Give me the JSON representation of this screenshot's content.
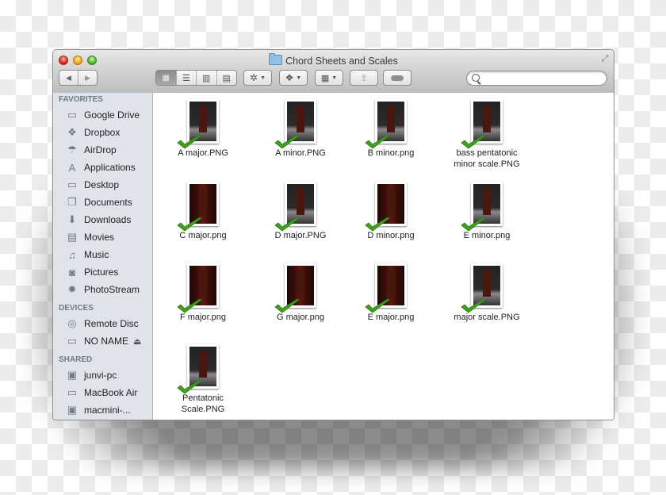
{
  "window": {
    "title": "Chord Sheets and Scales"
  },
  "toolbar": {
    "back_icon": "◀",
    "forward_icon": "▶",
    "view_icons": [
      "icon-view-icon",
      "list-view-icon",
      "column-view-icon",
      "cover-flow-view-icon"
    ],
    "view_glyphs": [
      "▦",
      "☰",
      "▥",
      "▤"
    ],
    "action_glyph": "✲",
    "dropbox_glyph": "❖",
    "arrange_glyph": "▦",
    "share_glyph": "⇪",
    "tags_glyph": "▬",
    "caret": "▼",
    "search_placeholder": "",
    "search_value": ""
  },
  "sidebar": {
    "favorites_title": "FAVORITES",
    "favorites": [
      {
        "label": "Google Drive",
        "icon": "folder-icon",
        "glyph": "▭"
      },
      {
        "label": "Dropbox",
        "icon": "dropbox-icon",
        "glyph": "❖"
      },
      {
        "label": "AirDrop",
        "icon": "airdrop-icon",
        "glyph": "☂"
      },
      {
        "label": "Applications",
        "icon": "applications-icon",
        "glyph": "A"
      },
      {
        "label": "Desktop",
        "icon": "desktop-icon",
        "glyph": "▭"
      },
      {
        "label": "Documents",
        "icon": "documents-icon",
        "glyph": "❐"
      },
      {
        "label": "Downloads",
        "icon": "downloads-icon",
        "glyph": "⬇"
      },
      {
        "label": "Movies",
        "icon": "movies-icon",
        "glyph": "▤"
      },
      {
        "label": "Music",
        "icon": "music-icon",
        "glyph": "♫"
      },
      {
        "label": "Pictures",
        "icon": "pictures-icon",
        "glyph": "◙"
      },
      {
        "label": "PhotoStream",
        "icon": "photostream-icon",
        "glyph": "✹"
      }
    ],
    "devices_title": "DEVICES",
    "devices": [
      {
        "label": "Remote Disc",
        "icon": "remote-disc-icon",
        "glyph": "◎"
      },
      {
        "label": "NO NAME",
        "icon": "drive-icon",
        "glyph": "▭",
        "eject": "⏏"
      }
    ],
    "shared_title": "SHARED",
    "shared": [
      {
        "label": "junvi-pc",
        "icon": "pc-icon",
        "glyph": "▣"
      },
      {
        "label": "MacBook Air",
        "icon": "laptop-icon",
        "glyph": "▭"
      },
      {
        "label": "macmini-...",
        "icon": "macmini-icon",
        "glyph": "▣"
      }
    ]
  },
  "files": [
    {
      "name": "A major.PNG",
      "style": "dark"
    },
    {
      "name": "A minor.PNG",
      "style": "dark"
    },
    {
      "name": "B minor.png",
      "style": "dark"
    },
    {
      "name": "bass pentatonic minor scale.PNG",
      "style": "dark"
    },
    {
      "name": "C major.png",
      "style": "red"
    },
    {
      "name": "D major.PNG",
      "style": "dark"
    },
    {
      "name": "D minor.png",
      "style": "red"
    },
    {
      "name": "E minor.png",
      "style": "dark"
    },
    {
      "name": "F major.png",
      "style": "red"
    },
    {
      "name": "G major.png",
      "style": "red"
    },
    {
      "name": "E major.png",
      "style": "red"
    },
    {
      "name": "major scale.PNG",
      "style": "dark"
    },
    {
      "name": "Pentatonic Scale.PNG",
      "style": "dark"
    }
  ],
  "colors": {
    "sidebar_bg": "#dfe4ea",
    "check_green": "#3fa11e"
  }
}
